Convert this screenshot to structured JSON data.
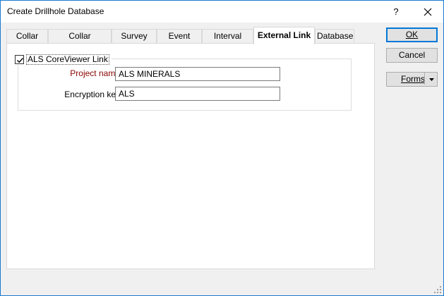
{
  "window": {
    "title": "Create Drillhole Database",
    "help_label": "?",
    "close_icon": "close-icon"
  },
  "tabs": [
    {
      "label": "Collar File",
      "active": false
    },
    {
      "label": "Collar Attributes",
      "active": false
    },
    {
      "label": "Survey File",
      "active": false
    },
    {
      "label": "Event Files",
      "active": false
    },
    {
      "label": "Interval Files",
      "active": false
    },
    {
      "label": "External Link",
      "active": true
    },
    {
      "label": "Database",
      "active": false
    }
  ],
  "external_link": {
    "group_label": "ALS CoreViewer Link",
    "group_checked": true,
    "project_name_label": "Project name",
    "project_name_value": "ALS MINERALS",
    "encryption_key_label": "Encryption key",
    "encryption_key_value": "ALS"
  },
  "buttons": {
    "ok": "OK",
    "cancel": "Cancel",
    "forms": "Forms"
  },
  "colors": {
    "required_label": "#8b0000",
    "default_button_border": "#0078d7",
    "window_border": "#1a7ad2"
  }
}
